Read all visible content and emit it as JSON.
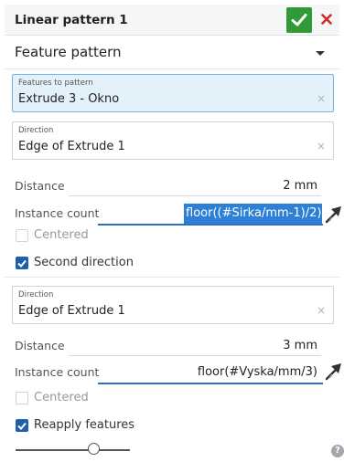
{
  "header": {
    "title": "Linear pattern 1"
  },
  "pattern_type": {
    "selected": "Feature pattern"
  },
  "features_to_pattern": {
    "label": "Features to pattern",
    "value": "Extrude 3 - Okno",
    "clear_icon": "×"
  },
  "direction1": {
    "label": "Direction",
    "value": "Edge of Extrude 1",
    "clear_icon": "×"
  },
  "distance1": {
    "label": "Distance",
    "value": "2 mm"
  },
  "instance_count1": {
    "label": "Instance count",
    "value": "floor((#Sirka/mm-1)/2)"
  },
  "centered1": {
    "label": "Centered",
    "checked": false
  },
  "second_direction": {
    "label": "Second direction",
    "checked": true
  },
  "direction2": {
    "label": "Direction",
    "value": "Edge of Extrude 1",
    "clear_icon": "×"
  },
  "distance2": {
    "label": "Distance",
    "value": "3 mm"
  },
  "instance_count2": {
    "label": "Instance count",
    "value": "floor(#Vyska/mm/3)"
  },
  "centered2": {
    "label": "Centered",
    "checked": false
  },
  "reapply_features": {
    "label": "Reapply features",
    "checked": true
  },
  "help": {
    "glyph": "?"
  },
  "colors": {
    "accept": "#2f9a36",
    "cancel": "#d42b2b",
    "accent": "#1f5fae",
    "selection": "#2e80d6"
  }
}
